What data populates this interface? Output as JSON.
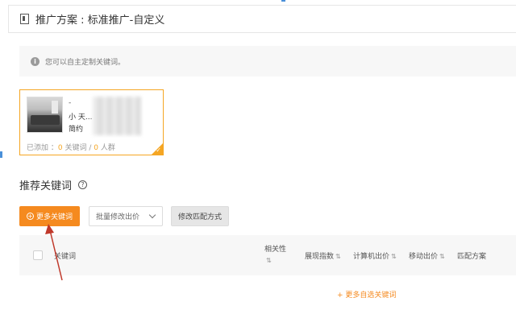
{
  "header": {
    "title": "推广方案 : 标准推广-自定义"
  },
  "tip": {
    "text": "您可以自主定制关键词。"
  },
  "product": {
    "line1": "-",
    "line2": "小 天...",
    "line3": "简约",
    "stats_prefix": "已添加 ：",
    "keyword_count": "0",
    "keyword_label": " 关键词 / ",
    "crowd_count": "0",
    "crowd_label": " 人群"
  },
  "section": {
    "title": "推荐关键词"
  },
  "toolbar": {
    "add_keywords_label": "更多关键词",
    "bulk_bid_placeholder": "批量修改出价",
    "match_mode_label": "修改匹配方式"
  },
  "table": {
    "columns": {
      "keyword": "关键词",
      "relevance": "相关性",
      "impressions": "展现指数",
      "pc_bid": "计算机出价",
      "mobile_bid": "移动出价",
      "match": "匹配方案"
    },
    "sort_glyph": "⇅"
  },
  "footer": {
    "more_keywords_link": "+ 更多自选关键词"
  },
  "colors": {
    "accent": "#f58a1f",
    "selected_border": "#f5a623",
    "annotation_arrow": "#c0392b"
  }
}
